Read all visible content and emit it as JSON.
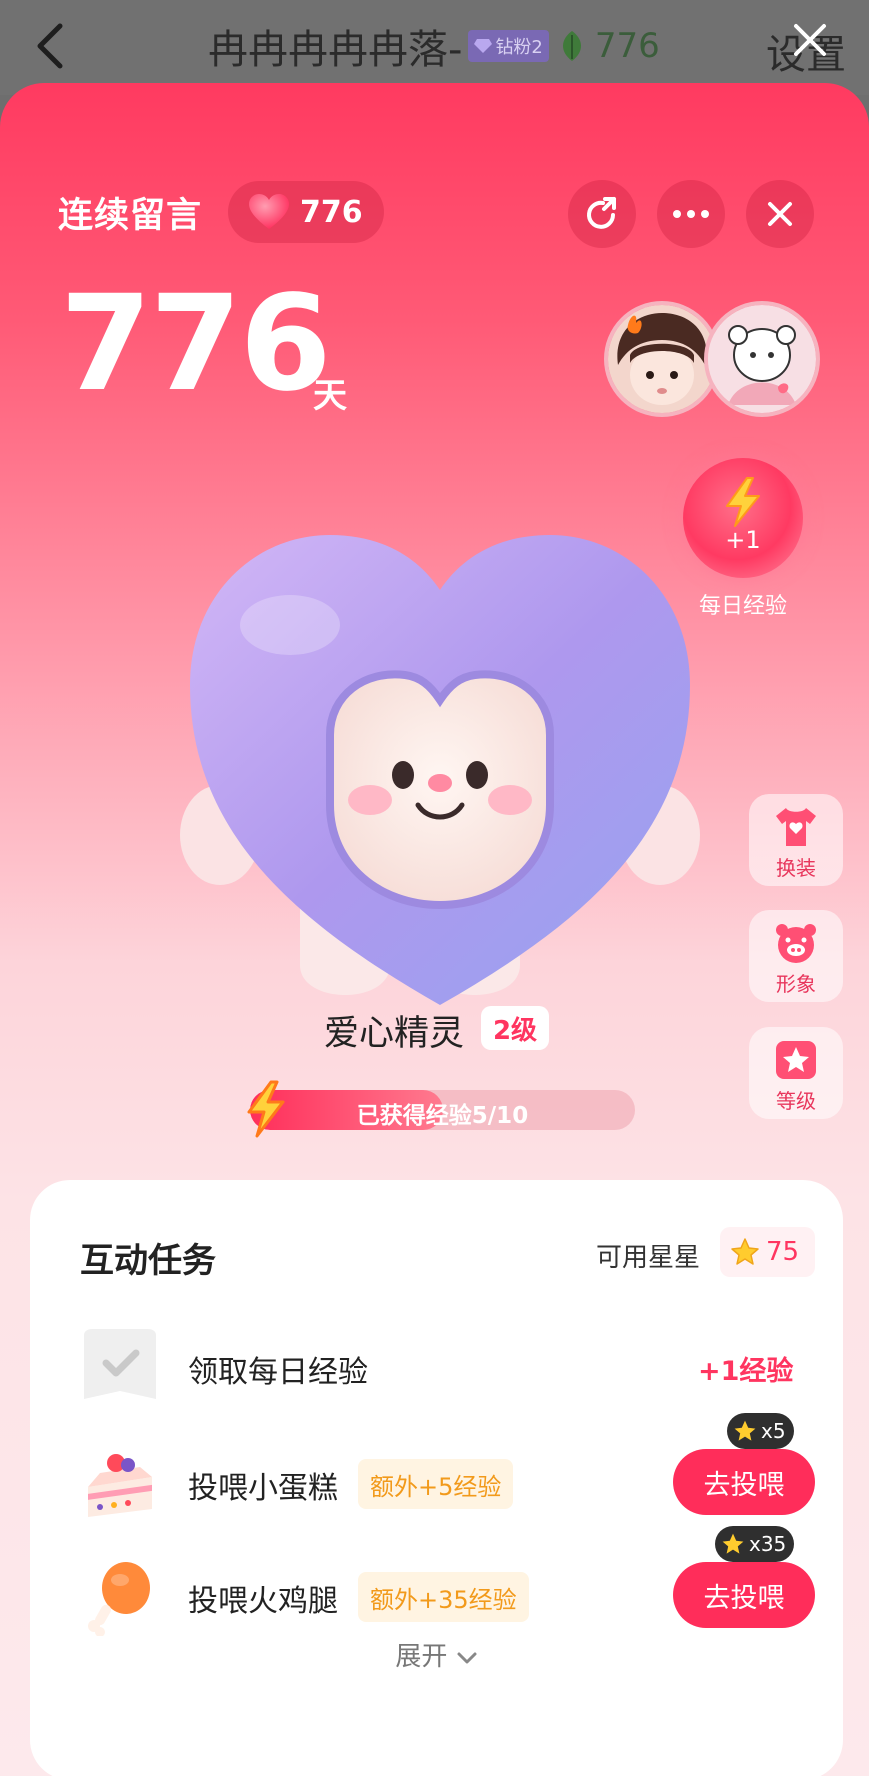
{
  "header": {
    "title": "冉冉冉冉冉落-",
    "badge": "钻粉2",
    "count": "776",
    "settings": "设置"
  },
  "panel": {
    "streak_label": "连续留言",
    "heart_count": "776",
    "days_value": "776",
    "days_unit": "天",
    "daily_exp_plus": "+1",
    "daily_exp_label": "每日经验",
    "side_buttons": [
      {
        "label": "换装",
        "icon": "shirt-icon"
      },
      {
        "label": "形象",
        "icon": "pig-face-icon"
      },
      {
        "label": "等级",
        "icon": "star-badge-icon"
      }
    ],
    "spirit_name": "爱心精灵",
    "spirit_level": "2级",
    "exp_text": "已获得经验5/10",
    "exp_progress": 0.5
  },
  "tasks": {
    "title": "互动任务",
    "stars_label": "可用星星",
    "stars_count": "75",
    "items": [
      {
        "name": "领取每日经验",
        "reward": "+1经验",
        "icon": "check-card-icon"
      },
      {
        "name": "投喂小蛋糕",
        "tag": "额外+5经验",
        "button": "去投喂",
        "cost": "x5",
        "icon": "cake-icon"
      },
      {
        "name": "投喂火鸡腿",
        "tag": "额外+35经验",
        "button": "去投喂",
        "cost": "x35",
        "icon": "drumstick-icon"
      }
    ],
    "expand_label": "展开"
  },
  "colors": {
    "accent": "#ff2d5a",
    "tag_text": "#f29a1b",
    "purple_heart": "#b79ef2"
  }
}
